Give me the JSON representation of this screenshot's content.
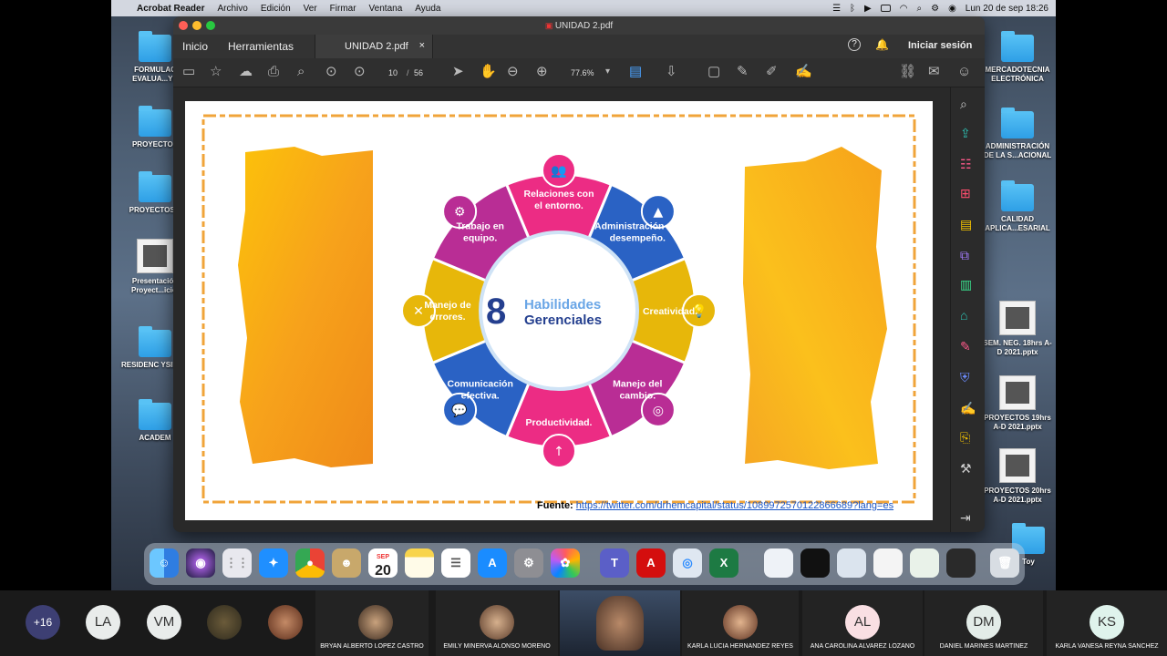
{
  "menubar": {
    "app": "Acrobat Reader",
    "items": [
      "Archivo",
      "Edición",
      "Ver",
      "Firmar",
      "Ventana",
      "Ayuda"
    ],
    "clock": "Lun 20 de sep  18:26"
  },
  "desktop": {
    "left": [
      "FORMULAC EVALUA...YE",
      "PROYECTOS",
      "PROYECTOS 2",
      "Presentación Proyect...icio.",
      "RESIDENC YSIDRO",
      "ACADEM"
    ],
    "right": [
      "MERCADOTECNIA ELECTRÓNICA",
      "ADMINISTRACIÓN DE LA S...ACIONAL",
      "CALIDAD APLICA...ESARIAL",
      "SEM. NEG. 18hrs A-D 2021.pptx",
      "PROYECTOS 19hrs A-D 2021.pptx",
      "PROYECTOS 20hrs A-D 2021.pptx",
      "Toy"
    ]
  },
  "window": {
    "title": "UNIDAD 2.pdf",
    "home_tab": "Inicio",
    "tools_tab": "Herramientas",
    "doc_tab": "UNIDAD 2.pdf",
    "close_tab": "×",
    "help": "?",
    "sign_in": "Iniciar sesión"
  },
  "toolbar": {
    "page_current": "10",
    "page_sep": "/",
    "page_total": "56",
    "zoom": "77.6%"
  },
  "slide": {
    "title_number": "8",
    "title_line1": "Habilidades",
    "title_line2": "Gerenciales",
    "segments": [
      "Relaciones con el entorno.",
      "Administración del desempeño.",
      "Creatividad.",
      "Manejo del cambio.",
      "Productividad.",
      "Comunicación efectiva.",
      "Manejo de errores.",
      "Trabajo en equipo."
    ],
    "source_label": "Fuente:",
    "source_url": "https://twitter.com/drhemcapital/status/1089972570122866689?lang=es"
  },
  "dock": {
    "calendar_month": "SEP",
    "calendar_day": "20"
  },
  "participants": {
    "more": "+16",
    "tiles": [
      {
        "initials": "LA"
      },
      {
        "initials": "VM"
      },
      {
        "name": "BRYAN ALBERTO LOPEZ CASTRO"
      },
      {
        "name": "EMILY MINERVA ALONSO MORENO"
      },
      {
        "name": "KARLA LUCIA HERNANDEZ REYES"
      },
      {
        "initials": "AL",
        "name": "ANA CAROLINA ALVAREZ LOZANO"
      },
      {
        "initials": "DM",
        "name": "DANIEL MARINES MARTINEZ"
      },
      {
        "initials": "KS",
        "name": "KARLA VANESA REYNA SANCHEZ"
      }
    ]
  }
}
